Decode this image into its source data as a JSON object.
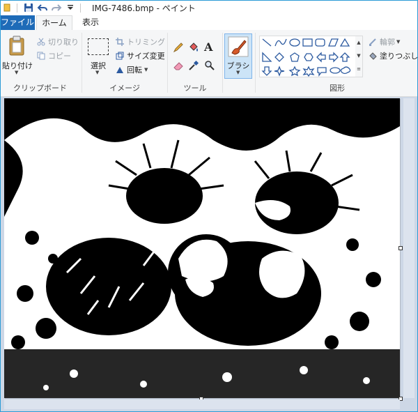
{
  "window": {
    "title": "IMG-7486.bmp - ペイント"
  },
  "tabs": {
    "file": "ファイル",
    "home": "ホーム",
    "view": "表示"
  },
  "clipboard": {
    "paste": "貼り付け",
    "cut": "切り取り",
    "copy": "コピー",
    "label": "クリップボード"
  },
  "image": {
    "select": "選択",
    "crop": "トリミング",
    "resize": "サイズ変更",
    "rotate": "回転",
    "label": "イメージ"
  },
  "tools": {
    "label": "ツール"
  },
  "brush": {
    "label": "ブラシ"
  },
  "shapes": {
    "outline": "輪郭",
    "fill": "塗りつぶし",
    "label": "図形"
  },
  "colors": {
    "accent": "#1e6bb8",
    "ribbon_bg": "#f5f6f7",
    "workspace_bg": "#cdd7e6",
    "brush_active": "#cce4f7"
  },
  "icons": [
    "save-icon",
    "undo-icon",
    "redo-icon",
    "customize-icon",
    "paste-icon",
    "cut-icon",
    "copy-icon",
    "select-icon",
    "crop-icon",
    "resize-icon",
    "rotate-icon",
    "pencil-icon",
    "fill-bucket-icon",
    "text-icon",
    "eraser-icon",
    "color-picker-icon",
    "magnifier-icon",
    "brush-icon",
    "outline-icon",
    "fill-icon"
  ]
}
